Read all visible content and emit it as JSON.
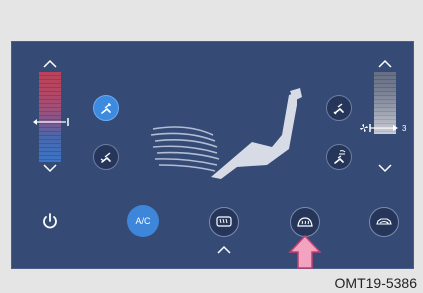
{
  "climate": {
    "ac_label": "A/C",
    "fan_level": "3",
    "active_mode": "face-vent",
    "highlighted_control": "front-defrost-button",
    "colors": {
      "panel": "#354a75",
      "active_button": "#3e86da",
      "pointer_arrow": "#f2a3c0"
    }
  },
  "caption": "OMT19-5386"
}
